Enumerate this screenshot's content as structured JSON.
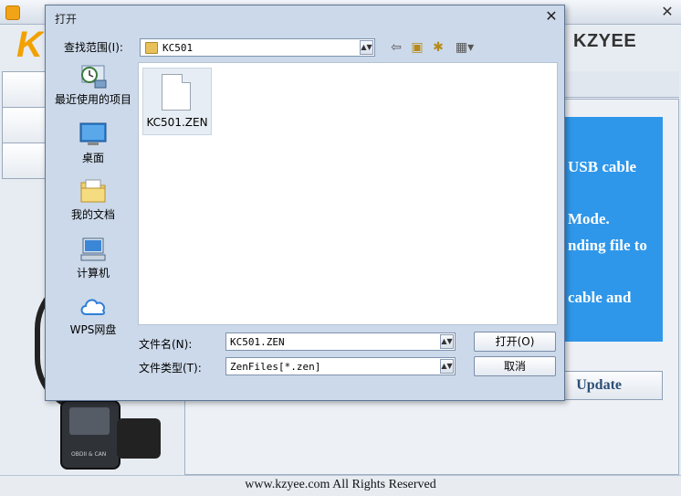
{
  "app": {
    "brand_left": "K",
    "brand_right": "KZYEE",
    "blue_lines": [
      "USB cable",
      "Mode.",
      "nding file to",
      "cable and"
    ],
    "update_label": "Update",
    "device_label": "OBDII & CAN",
    "footer": "www.kzyee.com  All Rights Reserved"
  },
  "dialog": {
    "title": "打开",
    "lookin_label": "查找范围(I):",
    "lookin_value": "KC501",
    "places": [
      {
        "label": "最近使用的项目",
        "icon": "recent-icon"
      },
      {
        "label": "桌面",
        "icon": "desktop-icon"
      },
      {
        "label": "我的文档",
        "icon": "documents-icon"
      },
      {
        "label": "计算机",
        "icon": "computer-icon"
      },
      {
        "label": "WPS网盘",
        "icon": "cloud-icon"
      }
    ],
    "files": [
      {
        "name": "KC501.ZEN"
      }
    ],
    "filename_label": "文件名(N):",
    "filename_value": "KC501.ZEN",
    "filetype_label": "文件类型(T):",
    "filetype_value": "ZenFiles[*.zen]",
    "open_label": "打开(O)",
    "cancel_label": "取消"
  },
  "colors": {
    "accent_blue": "#2f97ea",
    "brand_orange": "#f2a100"
  }
}
